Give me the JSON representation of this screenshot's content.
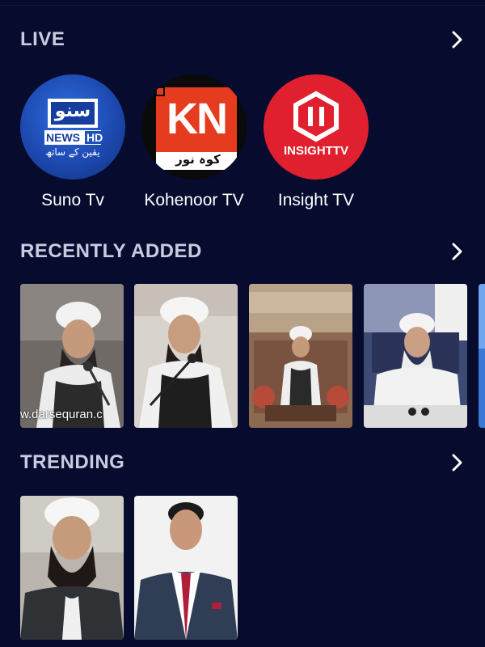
{
  "sections": {
    "live": {
      "title": "LIVE",
      "channels": [
        {
          "name": "Suno Tv",
          "logo_text": "سنو",
          "logo_sub": "NEWS",
          "logo_badge": "HD",
          "logo_tag": "یقین کے ساتھ"
        },
        {
          "name": "Kohenoor TV",
          "logo_text": "KN",
          "logo_sub": "کوہ نور"
        },
        {
          "name": "Insight TV",
          "logo_text": "INSIGHTTV"
        }
      ]
    },
    "recently_added": {
      "title": "RECENTLY ADDED",
      "items": [
        {
          "watermark": "w.darsequran.c"
        },
        {
          "watermark": ""
        },
        {
          "watermark": ""
        },
        {
          "watermark": ""
        }
      ]
    },
    "trending": {
      "title": "TRENDING"
    }
  },
  "colors": {
    "background": "#070b2e",
    "section_title": "#c9cbe0",
    "suno_blue": "#1f4fb8",
    "kohenoor_red": "#e53b1e",
    "insight_red": "#e0202e"
  }
}
